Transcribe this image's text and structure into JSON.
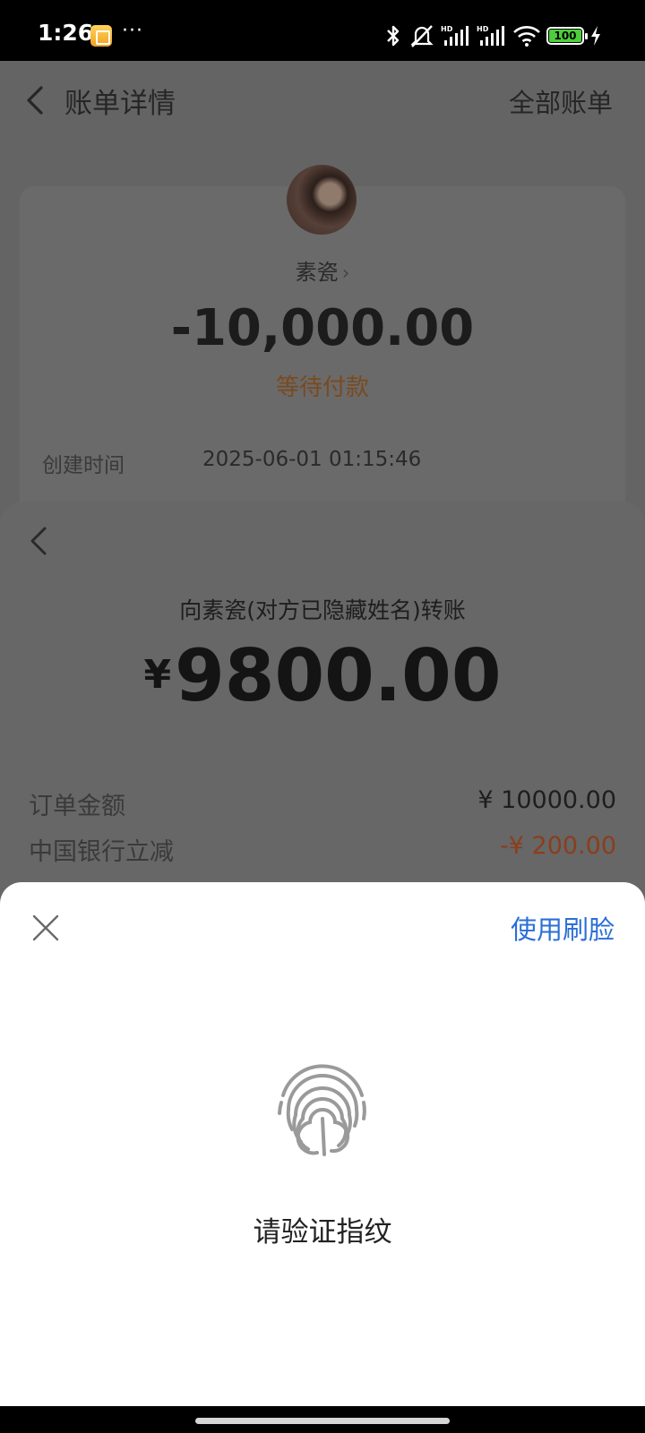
{
  "status_bar": {
    "time": "1:26",
    "dots": "···",
    "battery_level": "100",
    "icons": [
      "bluetooth-icon",
      "mute-icon",
      "hd-signal-icon",
      "hd-signal-icon",
      "wifi-icon",
      "battery-icon",
      "charging-icon"
    ]
  },
  "header": {
    "title": "账单详情",
    "right_link": "全部账单"
  },
  "bill": {
    "payee_name": "素瓷",
    "chevron": "›",
    "amount": "-10,000.00",
    "status": "等待付款",
    "created_label": "创建时间",
    "created_value": "2025-06-01 01:15:46"
  },
  "payment": {
    "description": "向素瓷(对方已隐藏姓名)转账",
    "currency_symbol": "¥",
    "amount": "9800.00",
    "details": [
      {
        "label": "订单金额",
        "value": "¥ 10000.00"
      },
      {
        "label": "中国银行立减",
        "value": "-¥ 200.00"
      }
    ]
  },
  "verification": {
    "alt_method": "使用刷脸",
    "prompt": "请验证指纹"
  },
  "colors": {
    "accent_blue": "#2a6fd6",
    "discount": "#8a3e1c",
    "pending_status": "#7a4a1e",
    "battery_green": "#4ccf3a"
  }
}
